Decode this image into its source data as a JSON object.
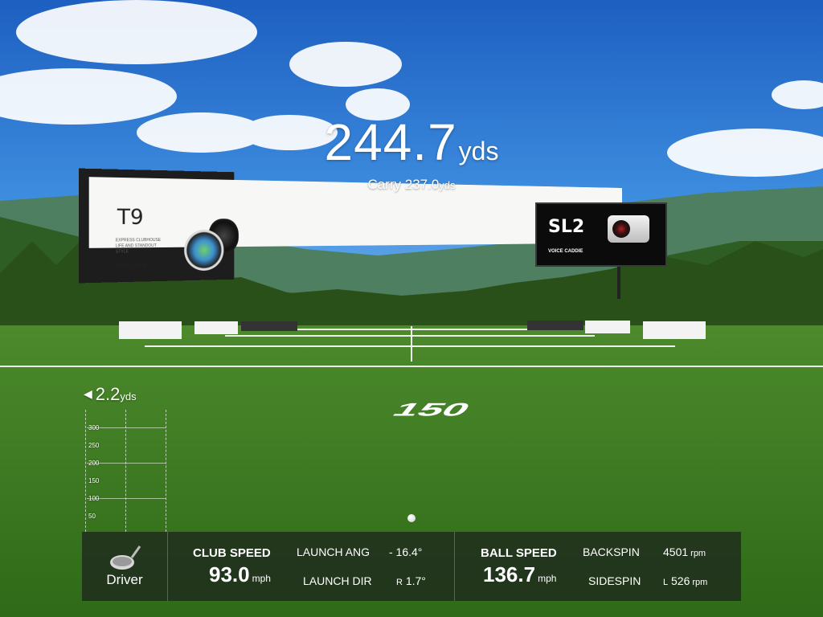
{
  "shot": {
    "total_distance": "244.7",
    "total_unit": "yds",
    "carry_label": "Carry",
    "carry_value": "237.0",
    "carry_unit": "yds",
    "side_distance": "2.2",
    "side_unit": "yds",
    "side_direction_icon": "left-arrow-icon"
  },
  "billboards": {
    "left": {
      "title": "T9",
      "tagline": "EXPRESS CLUBHOUSE LIFE AND STANDOUT STYLE",
      "brand": "VOICE CADDIE"
    },
    "right": {
      "title": "SL2",
      "brand": "VOICE CADDIE"
    }
  },
  "field_marking": "150",
  "ruler": {
    "ticks": [
      "300",
      "250",
      "200",
      "150",
      "100",
      "50"
    ]
  },
  "stats": {
    "club": {
      "icon": "driver-club-icon",
      "name": "Driver"
    },
    "club_speed": {
      "label": "CLUB SPEED",
      "value": "93.0",
      "unit": "mph"
    },
    "launch_angle": {
      "label": "LAUNCH ANG",
      "value": "- 16.4°"
    },
    "launch_direction": {
      "label": "LAUNCH DIR",
      "dir": "R",
      "value": "1.7°"
    },
    "ball_speed": {
      "label": "BALL SPEED",
      "value": "136.7",
      "unit": "mph"
    },
    "backspin": {
      "label": "BACKSPIN",
      "value": "4501",
      "unit": "rpm"
    },
    "sidespin": {
      "label": "SIDESPIN",
      "dir": "L",
      "value": "526",
      "unit": "rpm"
    }
  },
  "colors": {
    "sky_top": "#1d5fc0",
    "grass": "#3f7f22",
    "panel_bg": "#1e261e"
  }
}
